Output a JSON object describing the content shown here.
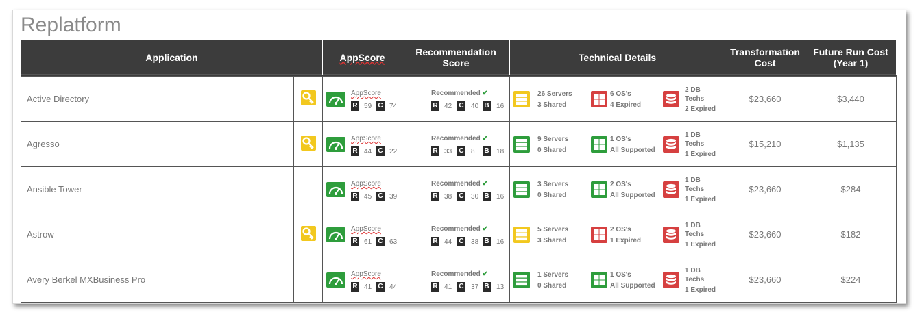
{
  "page": {
    "title": "Replatform"
  },
  "columns": [
    "Application",
    "AppScore",
    "Recommendation Score",
    "Technical Details",
    "Transformation Cost",
    "Future Run Cost (Year 1)"
  ],
  "appscore_label": "AppScore",
  "rec_label": "Recommended",
  "colors": {
    "header_bg": "#3c3c3c",
    "green": "#2e9d3c",
    "red": "#d64040",
    "yellow": "#f2c81f"
  },
  "rows": [
    {
      "name": "Active Directory",
      "key": true,
      "appscore": {
        "r": "59",
        "c": "74"
      },
      "recscore": {
        "r": "42",
        "c": "40",
        "b": "16"
      },
      "servers": {
        "line1": "26 Servers",
        "line2": "3 Shared",
        "status": "yellow"
      },
      "os": {
        "line1": "6 OS's",
        "line2": "4 Expired",
        "status": "red"
      },
      "db": {
        "line1": "2 DB",
        "line2": "Techs",
        "line3": "2 Expired",
        "status": "red"
      },
      "transformation_cost": "$23,660",
      "future_run_cost": "$3,440"
    },
    {
      "name": "Agresso",
      "key": true,
      "appscore": {
        "r": "44",
        "c": "22"
      },
      "recscore": {
        "r": "33",
        "c": "8",
        "b": "18"
      },
      "servers": {
        "line1": "9 Servers",
        "line2": "0 Shared",
        "status": "green"
      },
      "os": {
        "line1": "1 OS's",
        "line2": "All Supported",
        "status": "green"
      },
      "db": {
        "line1": "1 DB",
        "line2": "Techs",
        "line3": "1 Expired",
        "status": "red"
      },
      "transformation_cost": "$15,210",
      "future_run_cost": "$1,135"
    },
    {
      "name": "Ansible Tower",
      "key": false,
      "appscore": {
        "r": "45",
        "c": "39"
      },
      "recscore": {
        "r": "38",
        "c": "30",
        "b": "16"
      },
      "servers": {
        "line1": "3 Servers",
        "line2": "0 Shared",
        "status": "green"
      },
      "os": {
        "line1": "2 OS's",
        "line2": "All Supported",
        "status": "green"
      },
      "db": {
        "line1": "1 DB",
        "line2": "Techs",
        "line3": "1 Expired",
        "status": "red"
      },
      "transformation_cost": "$23,660",
      "future_run_cost": "$284"
    },
    {
      "name": "Astrow",
      "key": true,
      "appscore": {
        "r": "61",
        "c": "63"
      },
      "recscore": {
        "r": "44",
        "c": "38",
        "b": "16"
      },
      "servers": {
        "line1": "5 Servers",
        "line2": "3 Shared",
        "status": "yellow"
      },
      "os": {
        "line1": "2 OS's",
        "line2": "1 Expired",
        "status": "red"
      },
      "db": {
        "line1": "1 DB",
        "line2": "Techs",
        "line3": "1 Expired",
        "status": "red"
      },
      "transformation_cost": "$23,660",
      "future_run_cost": "$182"
    },
    {
      "name": "Avery Berkel MXBusiness Pro",
      "key": false,
      "appscore": {
        "r": "41",
        "c": "44"
      },
      "recscore": {
        "r": "41",
        "c": "37",
        "b": "13"
      },
      "servers": {
        "line1": "1 Servers",
        "line2": "0 Shared",
        "status": "green"
      },
      "os": {
        "line1": "1 OS's",
        "line2": "All Supported",
        "status": "green"
      },
      "db": {
        "line1": "1 DB",
        "line2": "Techs",
        "line3": "1 Expired",
        "status": "red"
      },
      "transformation_cost": "$23,660",
      "future_run_cost": "$224"
    }
  ]
}
